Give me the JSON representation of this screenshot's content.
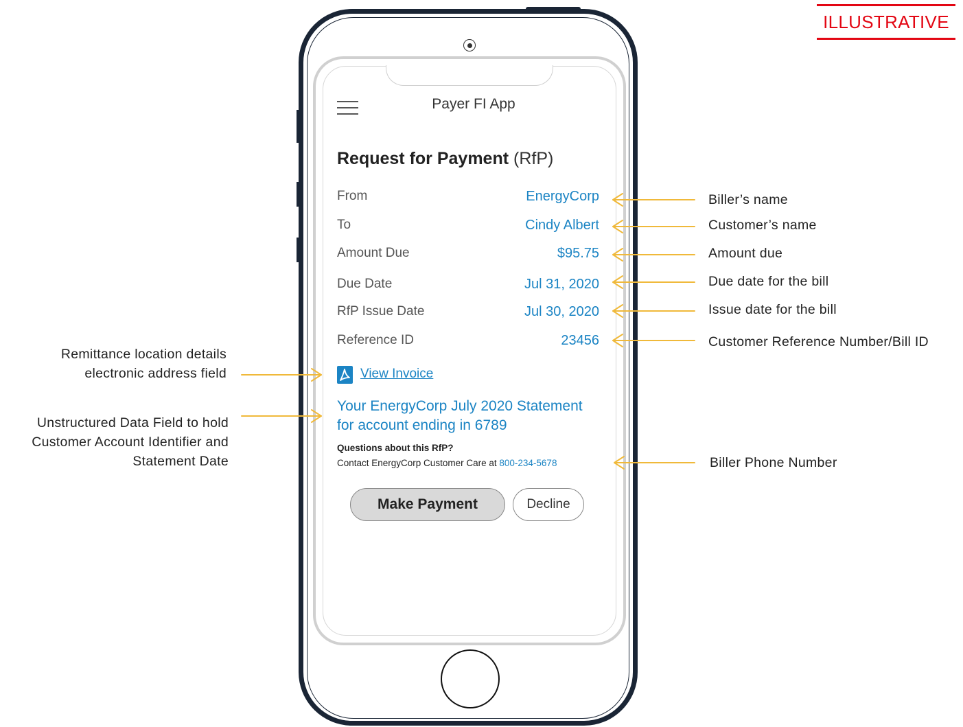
{
  "tag": "ILLUSTRATIVE",
  "app": {
    "title": "Payer FI App",
    "heading_bold": "Request for Payment",
    "heading_light": "(RfP)"
  },
  "rows": [
    {
      "label": "From",
      "value": "EnergyCorp"
    },
    {
      "label": "To",
      "value": "Cindy Albert"
    },
    {
      "label": "Amount Due",
      "value": "$95.75"
    },
    {
      "label": "Due Date",
      "value": "Jul 31, 2020"
    },
    {
      "label": "RfP Issue Date",
      "value": "Jul 30, 2020"
    },
    {
      "label": "Reference ID",
      "value": "23456"
    }
  ],
  "invoice": {
    "link_label": "View Invoice",
    "icon": "pdf-icon"
  },
  "statement": {
    "line1": "Your EnergyCorp July 2020 Statement",
    "line2": "for account ending in 6789"
  },
  "contact": {
    "question": "Questions about this RfP?",
    "text": "Contact EnergyCorp Customer Care at",
    "phone": "800-234-5678"
  },
  "buttons": {
    "pay": "Make Payment",
    "decline": "Decline"
  },
  "annotations": {
    "right": [
      "Biller’s name",
      "Customer’s name",
      "Amount due",
      "Due date for the bill",
      "Issue date for the bill",
      "Customer Reference Number/Bill ID",
      "Biller Phone Number"
    ],
    "left_remittance": [
      "Remittance location details",
      "electronic address field"
    ],
    "left_unstructured": [
      "Unstructured Data Field to hold",
      "Customer Account Identifier and",
      "Statement Date"
    ]
  },
  "colors": {
    "accent": "#1b84c4",
    "arrow": "#f0b93a",
    "tag": "#e30613",
    "phone_frame": "#1a2535"
  },
  "icons": [
    "hamburger-menu-icon",
    "pdf-icon",
    "camera-icon",
    "home-button-icon"
  ]
}
